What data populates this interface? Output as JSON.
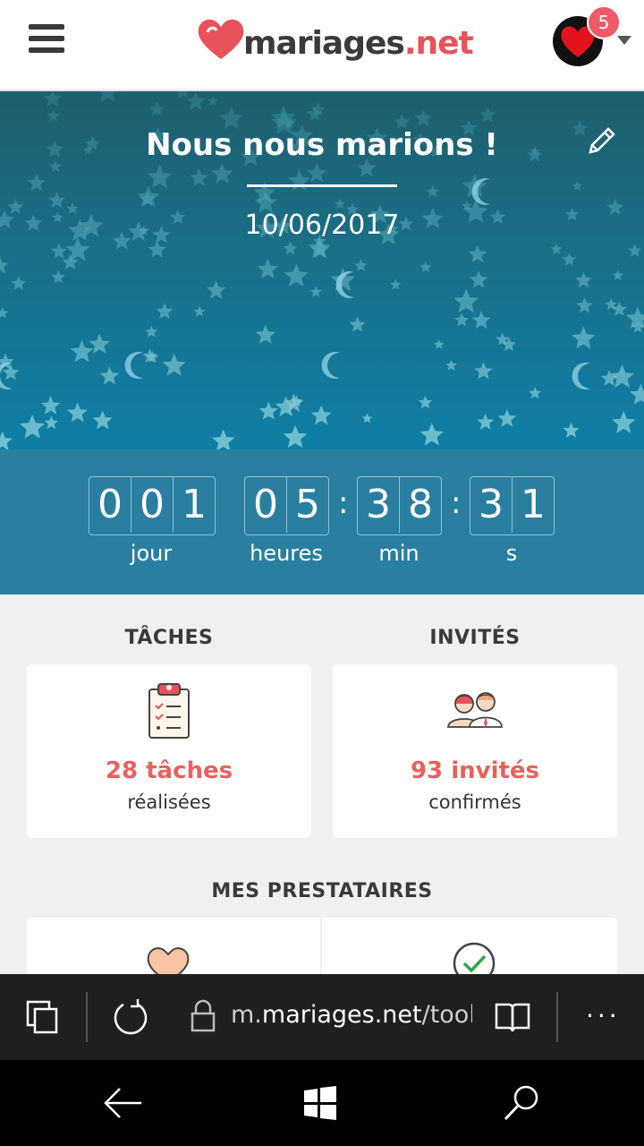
{
  "header": {
    "logo_text_main": "mariages",
    "logo_text_tld": ".net",
    "notification_count": "5"
  },
  "hero": {
    "title": "Nous nous marions !",
    "date": "10/06/2017"
  },
  "countdown": {
    "days": [
      "0",
      "0",
      "1"
    ],
    "hours": [
      "0",
      "5"
    ],
    "minutes": [
      "3",
      "8"
    ],
    "seconds": [
      "3",
      "1"
    ],
    "labels": {
      "days": "jour",
      "hours": "heures",
      "minutes": "min",
      "seconds": "s"
    }
  },
  "tasks": {
    "title": "TÂCHES",
    "main": "28 tâches",
    "sub": "réalisées"
  },
  "guests": {
    "title": "INVITÉS",
    "main": "93 invités",
    "sub": "confirmés"
  },
  "vendors": {
    "title": "MES PRESTATAIRES"
  },
  "browser": {
    "url_prefix": "m.",
    "url_host": "mariages.net",
    "url_path": "/tools"
  },
  "colors": {
    "accent": "#e8525a",
    "countdown_bg": "#2a7fa0"
  }
}
